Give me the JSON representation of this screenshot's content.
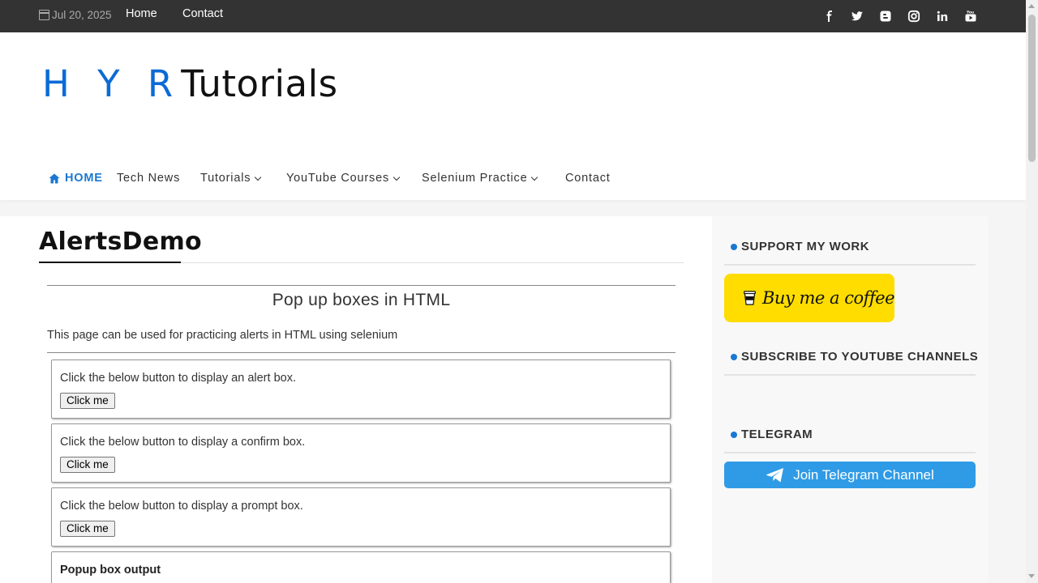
{
  "topbar": {
    "date": "Jul 20, 2025",
    "links": [
      "Home",
      "Contact"
    ],
    "social_icons": [
      "facebook-icon",
      "twitter-icon",
      "blogger-icon",
      "instagram-icon",
      "linkedin-icon",
      "youtube-icon"
    ]
  },
  "logo": {
    "hyr": "H Y R",
    "tutorials": "Tutorials"
  },
  "nav": {
    "home": "HOME",
    "tech_news": "Tech News",
    "tutorials": "Tutorials",
    "youtube_courses": "YouTube Courses",
    "selenium_practice": "Selenium Practice",
    "contact": "Contact"
  },
  "main": {
    "page_title": "AlertsDemo",
    "subheading": "Pop up boxes in HTML",
    "intro": "This page can be used for practicing alerts in HTML using selenium",
    "boxes": [
      {
        "text": "Click the below button to display an alert box.",
        "button": "Click me"
      },
      {
        "text": "Click the below button to display a confirm box.",
        "button": "Click me"
      },
      {
        "text": "Click the below button to display a prompt box.",
        "button": "Click me"
      }
    ],
    "output_label": "Popup box output"
  },
  "sidebar": {
    "support_title": "SUPPORT MY WORK",
    "coffee_label": "Buy me a coffee",
    "subscribe_title": "SUBSCRIBE TO YOUTUBE CHANNELS",
    "telegram_title": "TELEGRAM",
    "telegram_button": "Join Telegram Channel"
  },
  "colors": {
    "topbar": "#333333",
    "accent_blue": "#1a78d2",
    "coffee_yellow": "#ffdd00",
    "telegram_blue": "#2f9be6"
  }
}
